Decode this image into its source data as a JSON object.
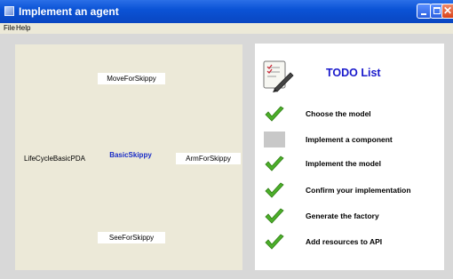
{
  "window": {
    "title": "Implement an agent"
  },
  "menubar": {
    "items": [
      {
        "label": "File"
      },
      {
        "label": "Help"
      }
    ]
  },
  "graph": {
    "center": "BasicSkippy",
    "nodes": {
      "top": "MoveForSkippy",
      "left": "LifeCycleBasicPDA",
      "right": "ArmForSkippy",
      "bottom": "SeeForSkippy"
    },
    "colors": {
      "center_text": "#1a2dc7",
      "panel_bg": "#ece9d8"
    }
  },
  "todo": {
    "title": "TODO List",
    "header_icon": "notepad-pen-icon",
    "items": [
      {
        "label": "Choose the model",
        "status": "done",
        "icon": "checkmark-icon"
      },
      {
        "label": "Implement a component",
        "status": "pending",
        "icon": "pending-box-icon"
      },
      {
        "label": "Implement the model",
        "status": "done",
        "icon": "checkmark-icon"
      },
      {
        "label": "Confirm your implementation",
        "status": "done",
        "icon": "checkmark-icon"
      },
      {
        "label": "Generate the factory",
        "status": "done",
        "icon": "checkmark-icon"
      },
      {
        "label": "Add resources to API",
        "status": "done",
        "icon": "checkmark-icon"
      }
    ],
    "colors": {
      "title_text": "#1a1acc",
      "check_green": "#4caf2a",
      "pending_gray": "#c8c8c8"
    }
  }
}
